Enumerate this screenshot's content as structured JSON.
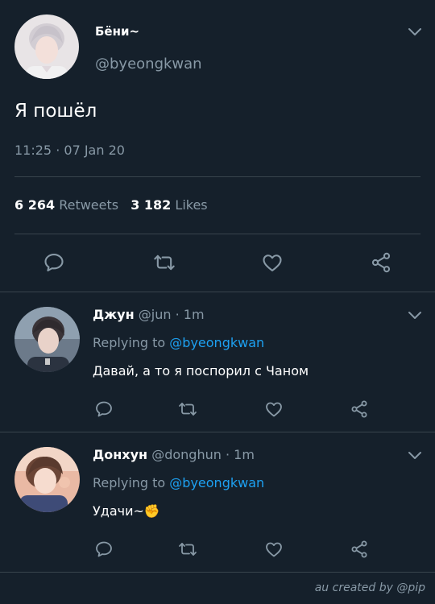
{
  "main_tweet": {
    "display_name": "Бёни~",
    "handle": "@byeongkwan",
    "text": "Я пошёл",
    "time": "11:25",
    "separator": "·",
    "date": "07 Jan 20",
    "retweets_count": "6 264",
    "retweets_label": "Retweets",
    "likes_count": "3 182",
    "likes_label": "Likes"
  },
  "replies": [
    {
      "display_name": "Джун",
      "handle": "@jun",
      "separator": "·",
      "age": "1m",
      "replying_label": "Replying to",
      "replying_handle": "@byeongkwan",
      "text": "Давай, а то я поспорил с Чаном"
    },
    {
      "display_name": "Донхун",
      "handle": "@donghun",
      "separator": "·",
      "age": "1m",
      "replying_label": "Replying to",
      "replying_handle": "@byeongkwan",
      "text": "Удачи~",
      "emoji": "✊"
    }
  ],
  "footer": {
    "credit": "au created by @pip"
  },
  "icons": [
    "chevron-down-icon",
    "reply-icon",
    "retweet-icon",
    "like-icon",
    "share-icon"
  ],
  "colors": {
    "background": "#15202b",
    "text": "#ffffff",
    "muted": "#8899a6",
    "accent": "#1da1f2",
    "divider": "#38444d"
  }
}
